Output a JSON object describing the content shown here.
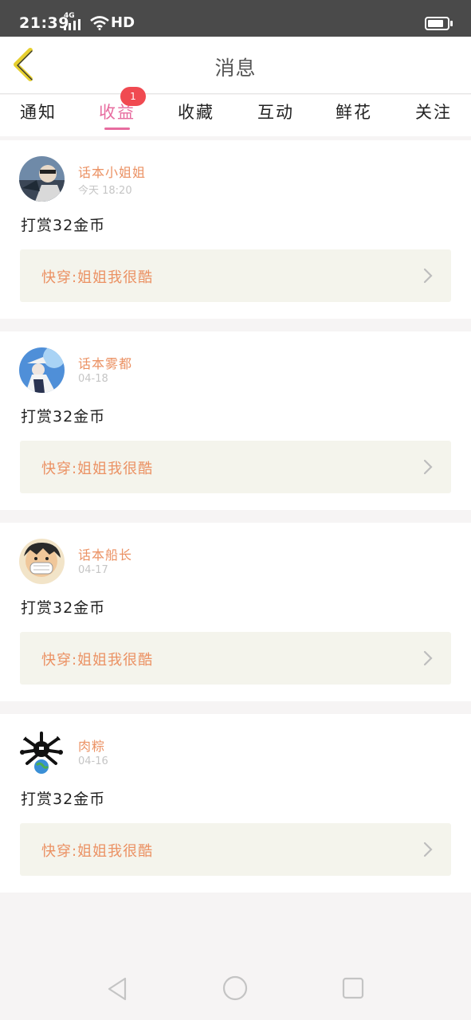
{
  "status_bar": {
    "time": "21:39",
    "network": "4G",
    "hd": "HD"
  },
  "header": {
    "title": "消息"
  },
  "tabs": [
    {
      "label": "通知",
      "active": false
    },
    {
      "label": "收益",
      "active": true,
      "badge": "1"
    },
    {
      "label": "收藏",
      "active": false
    },
    {
      "label": "互动",
      "active": false
    },
    {
      "label": "鲜花",
      "active": false
    },
    {
      "label": "关注",
      "active": false
    }
  ],
  "messages": [
    {
      "username": "话本小姐姐",
      "date": "今天 18:20",
      "text": "打赏32金币",
      "book": "快穿:姐姐我很酷"
    },
    {
      "username": "话本雾都",
      "date": "04-18",
      "text": "打赏32金币",
      "book": "快穿:姐姐我很酷"
    },
    {
      "username": "话本船长",
      "date": "04-17",
      "text": "打赏32金币",
      "book": "快穿:姐姐我很酷"
    },
    {
      "username": "肉粽",
      "date": "04-16",
      "text": "打赏32金币",
      "book": "快穿:姐姐我很酷"
    }
  ],
  "colors": {
    "accent": "#e76c9f",
    "username": "#eb9163",
    "badge": "#f04a51",
    "book_bg": "#f4f4ec",
    "back_icon": "#e6cf2f"
  },
  "icons": {
    "back": "chevron-left-icon",
    "book_arrow": "chevron-right-icon",
    "nav": [
      "back-triangle-icon",
      "home-circle-icon",
      "recents-square-icon"
    ]
  }
}
